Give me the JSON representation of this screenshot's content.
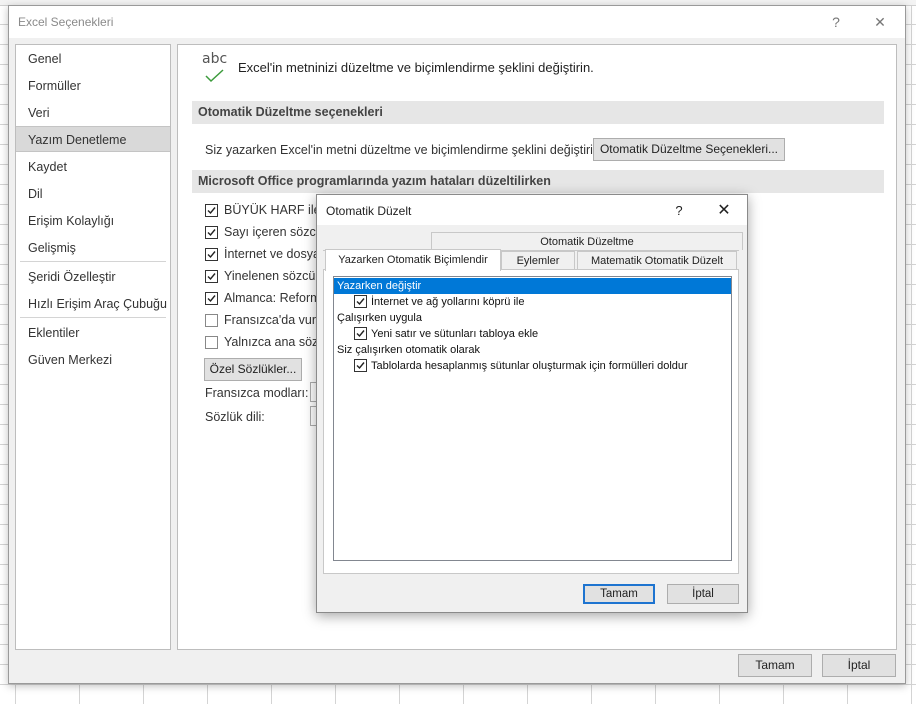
{
  "options_dialog": {
    "title": "Excel Seçenekleri",
    "help_button": "?",
    "close_button": "✕",
    "nav": [
      {
        "label": "Genel"
      },
      {
        "label": "Formüller"
      },
      {
        "label": "Veri"
      },
      {
        "label": "Yazım Denetleme",
        "selected": true
      },
      {
        "label": "Kaydet"
      },
      {
        "label": "Dil"
      },
      {
        "label": "Erişim Kolaylığı"
      },
      {
        "label": "Gelişmiş"
      },
      {
        "label": "Şeridi Özelleştir"
      },
      {
        "label": "Hızlı Erişim Araç Çubuğu"
      },
      {
        "label": "Eklentiler"
      },
      {
        "label": "Güven Merkezi"
      }
    ],
    "content": {
      "icon_text": "abc",
      "header": "Excel'in metninizi düzeltme ve biçimlendirme şeklini değiştirin.",
      "autocorrect_section": {
        "title": "Otomatik Düzeltme seçenekleri",
        "description": "Siz yazarken Excel'in metni düzeltme ve biçimlendirme şeklini değiştirin:",
        "button": "Otomatik Düzeltme Seçenekleri..."
      },
      "office_section": {
        "title": "Microsoft Office programlarında yazım hataları düzeltilirken",
        "options": [
          {
            "label": "BÜYÜK HARF ile y",
            "checked": true
          },
          {
            "label": "Sayı içeren sözcük",
            "checked": true
          },
          {
            "label": "İnternet ve dosya",
            "checked": true
          },
          {
            "label": "Yinelenen sözcükl",
            "checked": true
          },
          {
            "label": "Almanca: Reform",
            "checked": true
          },
          {
            "label": "Fransızca'da vurgu",
            "checked": false
          },
          {
            "label": "Yalnızca ana sözlü",
            "checked": false
          }
        ],
        "custom_dict_button": "Özel Sözlükler...",
        "french_modes_label": "Fransızca modları:",
        "dictionary_language_label": "Sözlük dili:"
      }
    },
    "footer": {
      "ok": "Tamam",
      "cancel": "İptal"
    }
  },
  "autocorrect_dialog": {
    "title": "Otomatik Düzelt",
    "help_button": "?",
    "close_button": "✕",
    "tabs_top": [
      "Otomatik Düzeltme"
    ],
    "tabs": [
      {
        "label": "Yazarken Otomatik Biçimlendir",
        "active": true
      },
      {
        "label": "Eylemler"
      },
      {
        "label": "Matematik Otomatik Düzelt"
      }
    ],
    "groups": [
      {
        "label": "Yazarken değiştir",
        "selected": true,
        "items": [
          {
            "label": "İnternet ve ağ yollarını köprü ile",
            "checked": true
          }
        ]
      },
      {
        "label": "Çalışırken uygula",
        "items": [
          {
            "label": "Yeni satır ve sütunları tabloya ekle",
            "checked": true
          }
        ]
      },
      {
        "label": "Siz çalışırken otomatik olarak",
        "items": [
          {
            "label": "Tablolarda hesaplanmış sütunlar oluşturmak için formülleri doldur",
            "checked": true
          }
        ]
      }
    ],
    "buttons": {
      "ok": "Tamam",
      "cancel": "İptal"
    }
  },
  "colors": {
    "selection_blue": "#0078d7",
    "default_button_border": "#1e74d0",
    "dialog_background": "#f0f0f0"
  }
}
